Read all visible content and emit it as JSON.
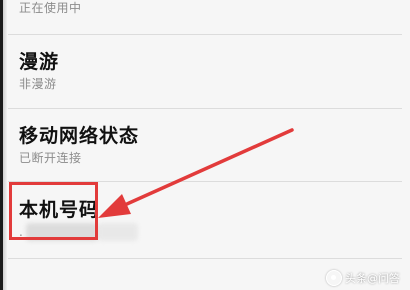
{
  "items": [
    {
      "title": "",
      "subtitle": "正在使用中"
    },
    {
      "title": "漫游",
      "subtitle": "非漫游"
    },
    {
      "title": "移动网络状态",
      "subtitle": "已断开连接"
    },
    {
      "title": "本机号码",
      "subtitle": "."
    }
  ],
  "watermark": {
    "text": "头条@问答"
  },
  "colors": {
    "highlight": "#e23b3b",
    "divider": "#dcdcdc"
  }
}
